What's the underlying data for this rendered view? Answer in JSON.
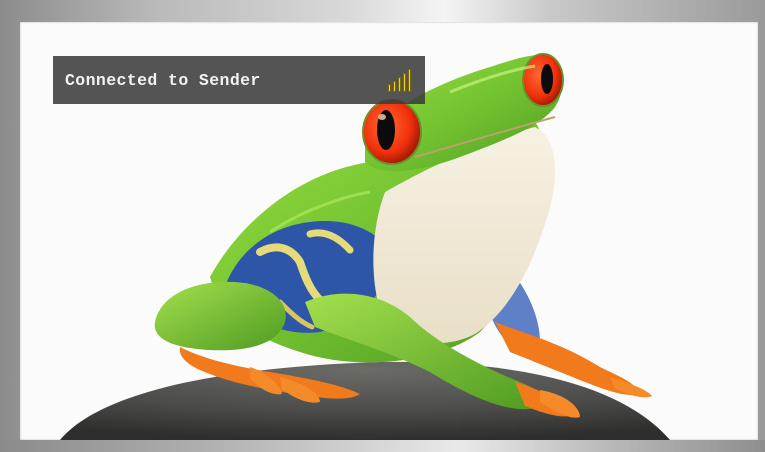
{
  "status_bar": {
    "text": "Connected to Sender",
    "signal_icon": "signal-strength-icon",
    "signal_bars": 5,
    "signal_color": "#f6d200"
  },
  "content": {
    "image_subject": "red-eyed tree frog on a rock",
    "colors": {
      "frog_green": "#7cc63a",
      "eye_red": "#ff3a12",
      "feet_orange": "#f07a1c",
      "rock": "#4a4a48"
    }
  }
}
